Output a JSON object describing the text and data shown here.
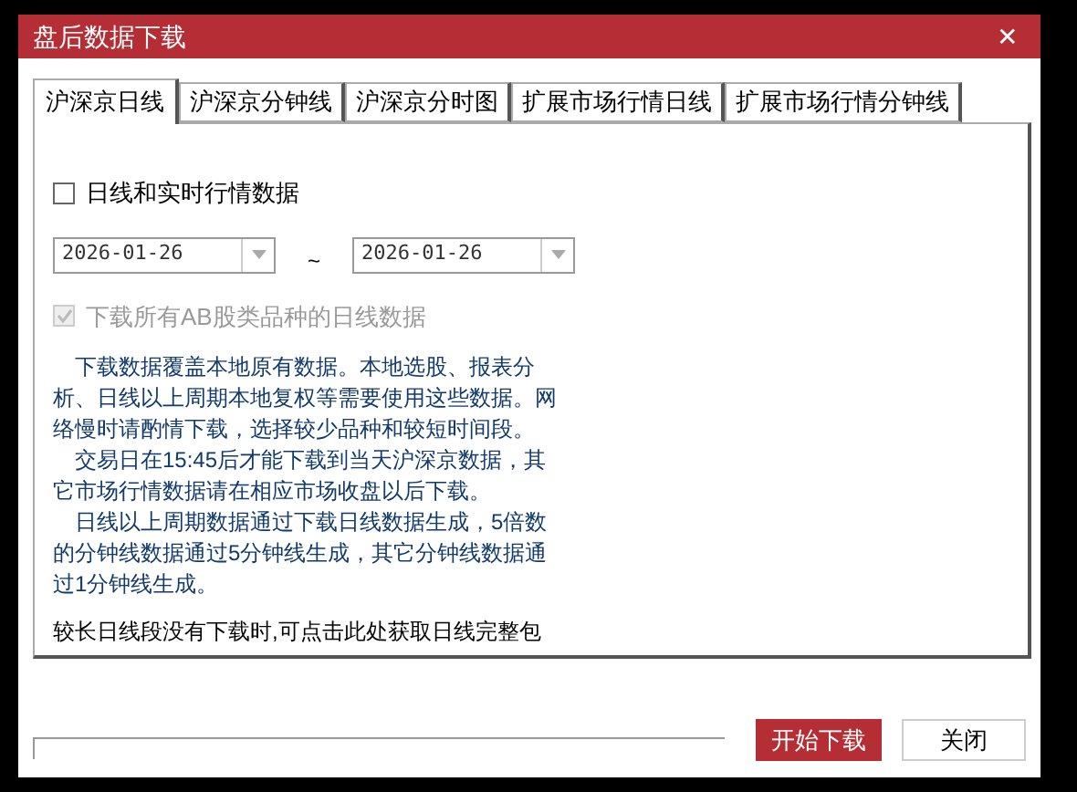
{
  "window": {
    "title": "盘后数据下载",
    "close": "✕"
  },
  "tabs": [
    {
      "label": "沪深京日线",
      "selected": true
    },
    {
      "label": "沪深京分钟线",
      "selected": false
    },
    {
      "label": "沪深京分时图",
      "selected": false
    },
    {
      "label": "扩展市场行情日线",
      "selected": false
    },
    {
      "label": "扩展市场行情分钟线",
      "selected": false
    }
  ],
  "realtime_checkbox": {
    "label": "日线和实时行情数据",
    "checked": false,
    "disabled": false
  },
  "date_range": {
    "start": "2026-01-26",
    "separator": "~",
    "end": "2026-01-26"
  },
  "ab_checkbox": {
    "label": "下载所有AB股类品种的日线数据",
    "checked": true,
    "disabled": true
  },
  "notes": [
    "下载数据覆盖本地原有数据。本地选股、报表分析、日线以上周期本地复权等需要使用这些数据。网络慢时请酌情下载，选择较少品种和较短时间段。",
    "交易日在15:45后才能下载到当天沪深京数据，其它市场行情数据请在相应市场收盘以后下载。",
    "日线以上周期数据通过下载日线数据生成，5倍数的分钟线数据通过5分钟线生成，其它分钟线数据通过1分钟线生成。"
  ],
  "link": "较长日线段没有下载时,可点击此处获取日线完整包",
  "progress": {
    "level": 0
  },
  "buttons": [
    {
      "label": "开始下载",
      "kind": "primary"
    },
    {
      "label": "关闭",
      "kind": "secondary"
    }
  ]
}
